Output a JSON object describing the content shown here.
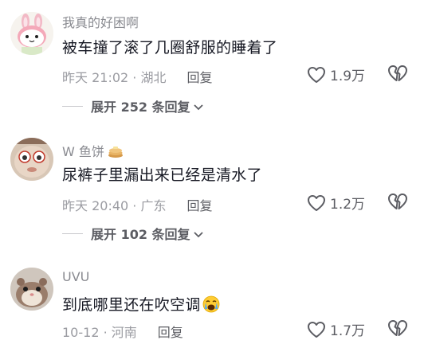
{
  "comments": [
    {
      "username": "我真的好困啊",
      "text": "被车撞了滚了几圈舒服的睡着了",
      "time": "昨天 21:02 · 湖北",
      "reply_label": "回复",
      "likes": "1.9万",
      "expand_label": "展开 252 条回复",
      "avatar_icon": "rabbit-avatar",
      "like_icon": "heart-outline-icon",
      "dislike_icon": "broken-heart-icon"
    },
    {
      "username": "W 鱼饼",
      "username_emoji": "pancake-emoji",
      "text": "尿裤子里漏出来已经是清水了",
      "time": "昨天 20:40 · 广东",
      "reply_label": "回复",
      "likes": "1.2万",
      "expand_label": "展开 102 条回复",
      "avatar_icon": "cartoon-face-avatar",
      "like_icon": "heart-outline-icon",
      "dislike_icon": "broken-heart-icon"
    },
    {
      "username": "UVU",
      "text": "到底哪里还在吹空调",
      "text_emoji": "crying-face-emoji",
      "time": "10-12 · 河南",
      "reply_label": "回复",
      "likes": "1.7万",
      "avatar_icon": "hamster-avatar",
      "like_icon": "heart-outline-icon",
      "dislike_icon": "broken-heart-icon"
    }
  ],
  "colors": {
    "text_primary": "#161823",
    "text_secondary": "#8a8b91",
    "icon": "#5c5d63"
  }
}
